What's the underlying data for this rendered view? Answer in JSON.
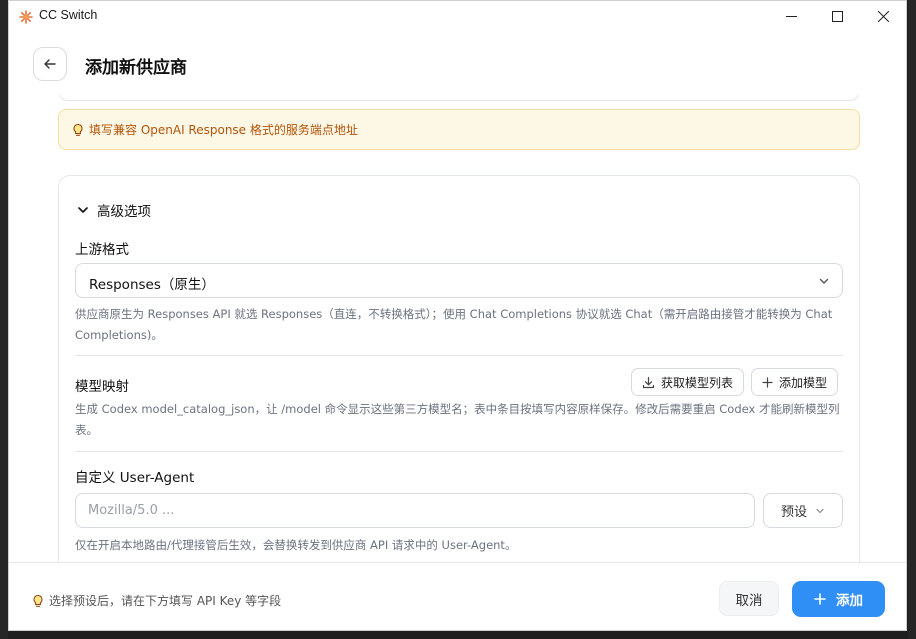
{
  "window": {
    "title": "CC Switch"
  },
  "header": {
    "title": "添加新供应商"
  },
  "hint": {
    "text": "填写兼容 OpenAI Response 格式的服务端点地址"
  },
  "advanced": {
    "title": "高级选项",
    "upstream_format": {
      "label": "上游格式",
      "selected": "Responses（原生）",
      "help": "供应商原生为 Responses API 就选 Responses（直连，不转换格式）；使用 Chat Completions 协议就选 Chat（需开启路由接管才能转换为 Chat Completions)。"
    },
    "model_mapping": {
      "label": "模型映射",
      "fetch_label": "获取模型列表",
      "add_label": "添加模型",
      "help": "生成 Codex model_catalog_json，让 /model 命令显示这些第三方模型名；表中条目按填写内容原样保存。修改后需要重启 Codex 才能刷新模型列表。"
    },
    "user_agent": {
      "label": "自定义 User-Agent",
      "placeholder": "Mozilla/5.0 ...",
      "preset_label": "预设",
      "help": "仅在开启本地路由/代理接管后生效，会替换转发到供应商 API 请求中的 User-Agent。"
    }
  },
  "footer": {
    "hint": "选择预设后，请在下方填写 API Key 等字段",
    "cancel_label": "取消",
    "add_label": "添加"
  },
  "colors": {
    "accent": "#2f8ff5",
    "hint_text": "#b45309",
    "hint_bg": "#fdf8e6",
    "app_icon": "#e8743b"
  }
}
